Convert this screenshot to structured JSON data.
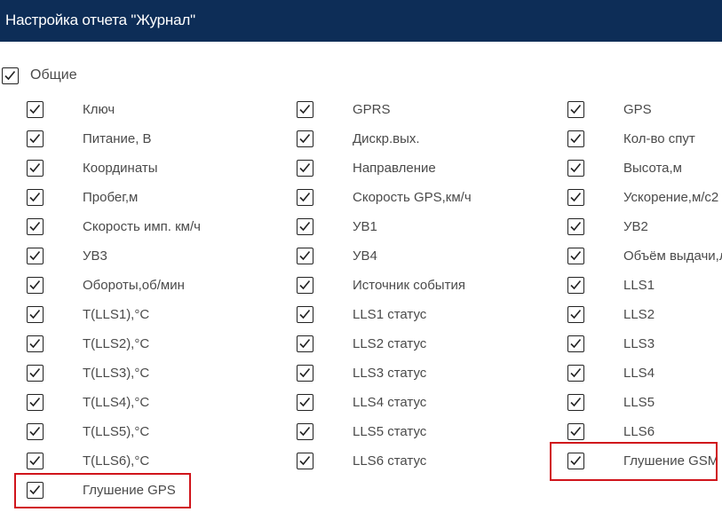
{
  "header": {
    "title": "Настройка отчета \"Журнал\""
  },
  "group": {
    "label": "Общие",
    "checked": true
  },
  "columns": [
    {
      "items": [
        {
          "label": "Ключ",
          "checked": true
        },
        {
          "label": "Питание, В",
          "checked": true
        },
        {
          "label": "Координаты",
          "checked": true
        },
        {
          "label": "Пробег,м",
          "checked": true
        },
        {
          "label": "Скорость имп. км/ч",
          "checked": true
        },
        {
          "label": "УВ3",
          "checked": true
        },
        {
          "label": "Обороты,об/мин",
          "checked": true
        },
        {
          "label": "T(LLS1),°C",
          "checked": true
        },
        {
          "label": "T(LLS2),°C",
          "checked": true
        },
        {
          "label": "T(LLS3),°C",
          "checked": true
        },
        {
          "label": "T(LLS4),°C",
          "checked": true
        },
        {
          "label": "T(LLS5),°C",
          "checked": true
        },
        {
          "label": "T(LLS6),°C",
          "checked": true
        },
        {
          "label": "Глушение GPS",
          "checked": true,
          "highlighted": true
        }
      ]
    },
    {
      "items": [
        {
          "label": "GPRS",
          "checked": true
        },
        {
          "label": "Дискр.вых.",
          "checked": true
        },
        {
          "label": "Направление",
          "checked": true
        },
        {
          "label": "Скорость GPS,км/ч",
          "checked": true
        },
        {
          "label": "УВ1",
          "checked": true
        },
        {
          "label": "УВ4",
          "checked": true
        },
        {
          "label": "Источник события",
          "checked": true
        },
        {
          "label": "LLS1 статус",
          "checked": true
        },
        {
          "label": "LLS2 статус",
          "checked": true
        },
        {
          "label": "LLS3 статус",
          "checked": true
        },
        {
          "label": "LLS4 статус",
          "checked": true
        },
        {
          "label": "LLS5 статус",
          "checked": true
        },
        {
          "label": "LLS6 статус",
          "checked": true
        }
      ]
    },
    {
      "items": [
        {
          "label": "GPS",
          "checked": true
        },
        {
          "label": "Кол-во спут",
          "checked": true
        },
        {
          "label": "Высота,м",
          "checked": true
        },
        {
          "label": "Ускорение,м/с2",
          "checked": true
        },
        {
          "label": "УВ2",
          "checked": true
        },
        {
          "label": "Объём выдачи,л",
          "checked": true
        },
        {
          "label": "LLS1",
          "checked": true
        },
        {
          "label": "LLS2",
          "checked": true
        },
        {
          "label": "LLS3",
          "checked": true
        },
        {
          "label": "LLS4",
          "checked": true
        },
        {
          "label": "LLS5",
          "checked": true
        },
        {
          "label": "LLS6",
          "checked": true
        },
        {
          "label": "Глушение GSM",
          "checked": true,
          "highlighted": true
        }
      ]
    }
  ],
  "colors": {
    "header_bg": "#0d2d57",
    "highlight": "#d0141b"
  }
}
